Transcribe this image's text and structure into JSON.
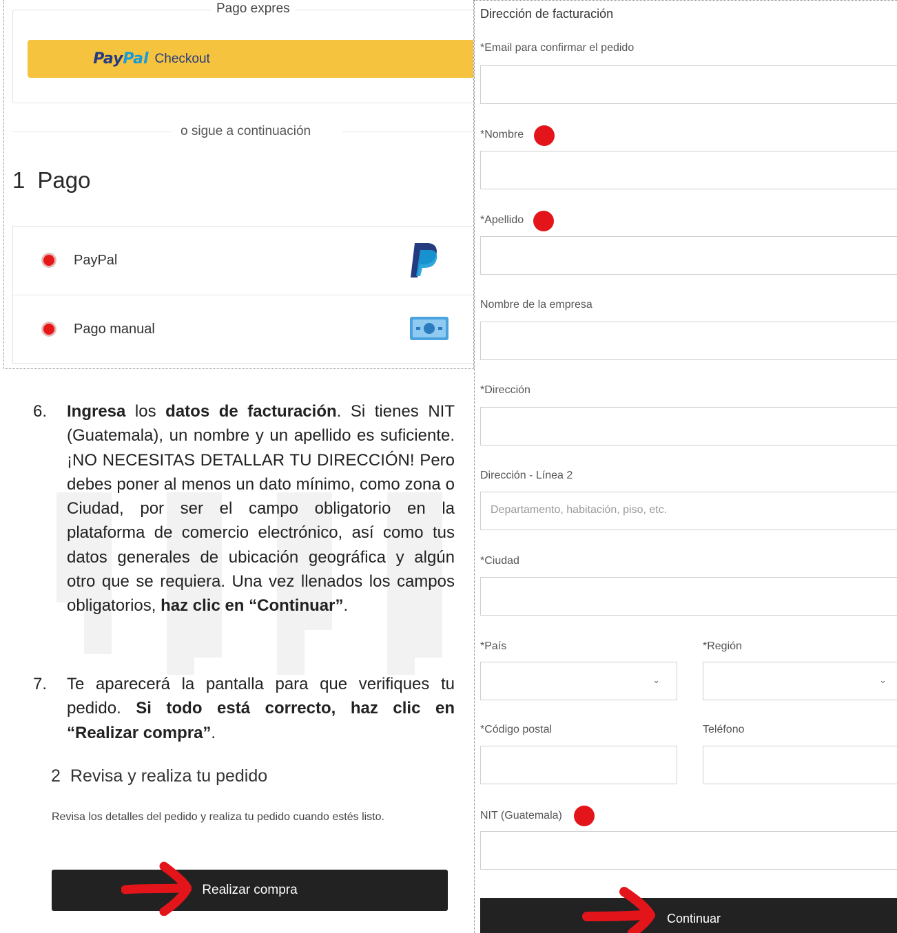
{
  "express": {
    "title": "Pago expres",
    "paypal_pay": "Pay",
    "paypal_pal": "Pal",
    "paypal_checkout": "Checkout"
  },
  "divider_text": "o sigue a continuación",
  "payment": {
    "number": "1",
    "title": "Pago",
    "methods": [
      {
        "label": "PayPal",
        "icon": "paypal-logo-icon"
      },
      {
        "label": "Pago manual",
        "icon": "cash-bill-icon"
      }
    ],
    "selected_color": "#e41818"
  },
  "steps": {
    "step6": {
      "num": "6.",
      "b1": "Ingresa",
      "t1": " los ",
      "b2": "datos de facturación",
      "t2": ". Si tienes NIT (Guatemala), un nombre y un apellido es suficiente. ¡NO NECESITAS DETALLAR TU DIRECCIÓN! Pero debes poner al menos un dato mínimo, como zona o Ciudad, por ser el campo obligatorio en la plataforma de comercio electrónico, así como tus datos generales de ubicación geográfica y algún otro que se requiera. Una vez llenados los campos obligatorios, ",
      "b3": "haz clic en “Continuar”",
      "t3": "."
    },
    "step7": {
      "num": "7.",
      "t1": "Te aparecerá la pantalla para que verifiques tu pedido. ",
      "b1": "Si todo está correcto, haz clic en “Realizar compra”",
      "t2": "."
    }
  },
  "review": {
    "number": "2",
    "title": "Revisa y realiza tu pedido",
    "description": "Revisa los detalles del pedido y realiza tu pedido cuando estés listo.",
    "button": "Realizar compra"
  },
  "billing": {
    "title": "Dirección de facturación",
    "email_label": "*Email para confirmar el pedido",
    "nombre_label": "*Nombre",
    "apellido_label": "*Apellido",
    "empresa_label": "Nombre de la empresa",
    "direccion_label": "*Dirección",
    "direccion2_label": "Dirección - Línea 2",
    "direccion2_placeholder": "Departamento, habitación, piso, etc.",
    "ciudad_label": "*Ciudad",
    "pais_label": "*País",
    "region_label": "*Región",
    "postal_label": "*Código postal",
    "telefono_label": "Teléfono",
    "nit_label": "NIT (Guatemala)",
    "button": "Continuar"
  },
  "colors": {
    "paypal_button": "#f6c33f",
    "annotation_red": "#e4151a",
    "dark_button": "#222222"
  }
}
